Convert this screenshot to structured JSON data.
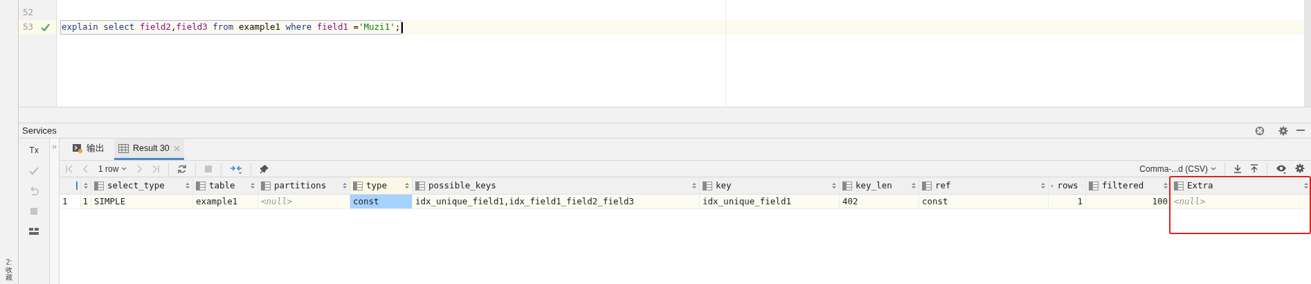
{
  "editor": {
    "lines": [
      {
        "number": "52",
        "current": false,
        "checked": false
      },
      {
        "number": "53",
        "current": true,
        "checked": true,
        "tokens": [
          {
            "kind": "keyword",
            "text": "explain select"
          },
          {
            "kind": "field",
            "text": " field2"
          },
          {
            "kind": "plain",
            "text": ","
          },
          {
            "kind": "field",
            "text": "field3"
          },
          {
            "kind": "keyword",
            "text": " from"
          },
          {
            "kind": "plain",
            "text": " example1"
          },
          {
            "kind": "keyword",
            "text": " where"
          },
          {
            "kind": "field",
            "text": " field1"
          },
          {
            "kind": "plain",
            "text": " ="
          },
          {
            "kind": "string",
            "text": "'Muzi1'"
          },
          {
            "kind": "plain",
            "text": ";"
          }
        ]
      }
    ]
  },
  "services": {
    "title": "Services",
    "side_tab": "2: 收藏",
    "left_tool": "Tx",
    "collapse_toggle": "››",
    "tabs": [
      {
        "label": "输出",
        "selected": false,
        "closable": false
      },
      {
        "label": "Result 30",
        "selected": true,
        "closable": true
      }
    ],
    "toolbar": {
      "rows": "1 row",
      "format": "Comma-...d (CSV)"
    },
    "table": {
      "columns": [
        {
          "kind": "rownum",
          "highlighted": false
        },
        {
          "kind": "number",
          "highlighted": false
        },
        {
          "name": "select_type",
          "kind": "text",
          "highlighted": false
        },
        {
          "name": "table",
          "kind": "text",
          "highlighted": false
        },
        {
          "name": "partitions",
          "kind": "text",
          "highlighted": false
        },
        {
          "name": "type",
          "kind": "text",
          "highlighted": false
        },
        {
          "name": "possible_keys",
          "kind": "text",
          "highlighted": false
        },
        {
          "name": "key",
          "kind": "text",
          "highlighted": false
        },
        {
          "name": "key_len",
          "kind": "text",
          "highlighted": false
        },
        {
          "name": "ref",
          "kind": "text",
          "highlighted": false
        },
        {
          "name": "rows",
          "kind": "number",
          "highlighted": false
        },
        {
          "name": "filtered",
          "kind": "number",
          "highlighted": false
        },
        {
          "name": "Extra",
          "kind": "text",
          "highlighted": true
        }
      ],
      "rows": [
        {
          "cells": [
            {
              "text": "1",
              "null": false,
              "selected": false
            },
            {
              "text": "1",
              "null": false,
              "selected": false
            },
            {
              "text": "SIMPLE",
              "null": false,
              "selected": false
            },
            {
              "text": "example1",
              "null": false,
              "selected": false
            },
            {
              "text": "<null>",
              "null": true,
              "selected": false
            },
            {
              "text": "const",
              "null": false,
              "selected": true
            },
            {
              "text": "idx_unique_field1,idx_field1_field2_field3",
              "null": false,
              "selected": false
            },
            {
              "text": "idx_unique_field1",
              "null": false,
              "selected": false
            },
            {
              "text": "402",
              "null": false,
              "selected": false
            },
            {
              "text": "const",
              "null": false,
              "selected": false
            },
            {
              "text": "1",
              "null": false,
              "selected": false
            },
            {
              "text": "100",
              "null": false,
              "selected": false
            },
            {
              "text": "<null>",
              "null": true,
              "selected": false
            }
          ]
        }
      ]
    }
  }
}
